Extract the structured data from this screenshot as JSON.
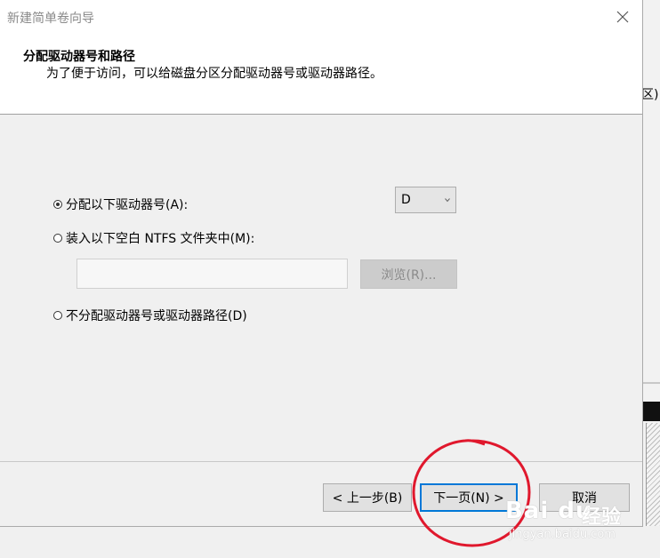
{
  "window": {
    "title": "新建简单卷向导"
  },
  "header": {
    "title": "分配驱动器号和路径",
    "description": "为了便于访问，可以给磁盘分区分配驱动器号或驱动器路径。"
  },
  "options": {
    "assign_letter": {
      "label": "分配以下驱动器号(A):",
      "checked": true
    },
    "mount_folder": {
      "label": "装入以下空白 NTFS 文件夹中(M):",
      "checked": false
    },
    "no_assign": {
      "label": "不分配驱动器号或驱动器路径(D)",
      "checked": false
    }
  },
  "drive_letter_select": {
    "value": "D"
  },
  "folder_path": {
    "value": ""
  },
  "browse_button": {
    "label": "浏览(R)...",
    "enabled": false
  },
  "footer": {
    "back_label": "< 上一步(B)",
    "next_label": "下一页(N) >",
    "cancel_label": "取消"
  },
  "background_app": {
    "text": "区)"
  },
  "watermark": {
    "logo": "Bai du",
    "text": "经验",
    "url": "jingyan.baidu.com"
  },
  "colors": {
    "accent": "#0078d7",
    "annotation_red": "#e0182d"
  }
}
